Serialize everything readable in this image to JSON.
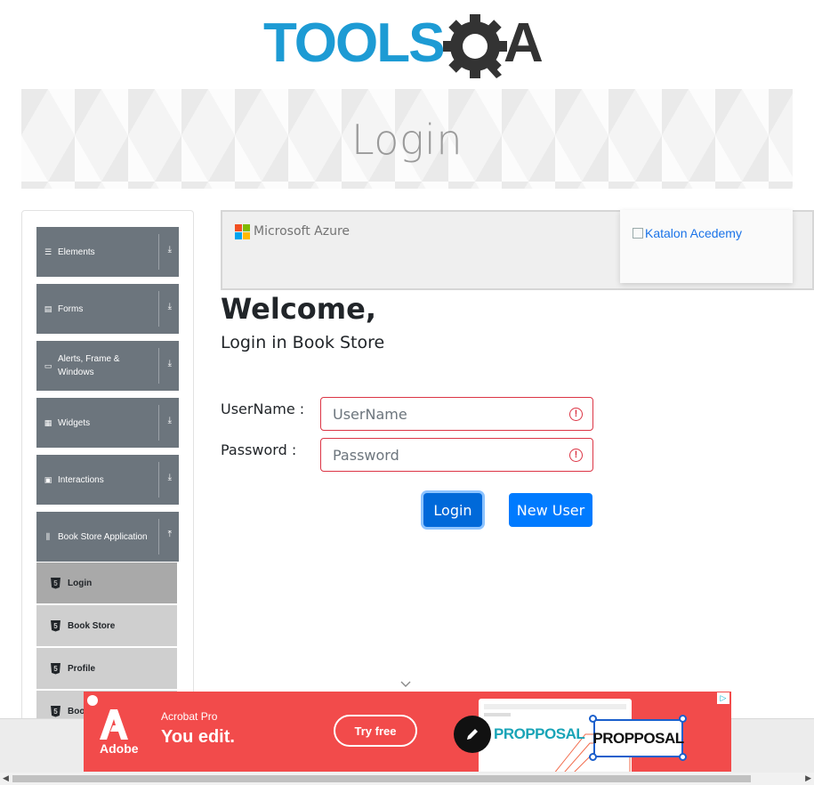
{
  "header": {
    "logo_text": "TOOLSQA"
  },
  "banner": {
    "title": "Login"
  },
  "sidebar": {
    "groups": [
      {
        "label": "Elements",
        "icon": "list-icon",
        "arrow": "⤓"
      },
      {
        "label": "Forms",
        "icon": "form-icon",
        "arrow": "⤓"
      },
      {
        "label": "Alerts, Frame & Windows",
        "icon": "window-icon",
        "arrow": "⤓"
      },
      {
        "label": "Widgets",
        "icon": "grid-icon",
        "arrow": "⤓"
      },
      {
        "label": "Interactions",
        "icon": "doc-icon",
        "arrow": "⤓"
      },
      {
        "label": "Book Store Application",
        "icon": "books-icon",
        "arrow": "⤒"
      }
    ],
    "subitems": [
      {
        "label": "Login",
        "active": true
      },
      {
        "label": "Book Store",
        "active": false
      },
      {
        "label": "Profile",
        "active": false
      },
      {
        "label": "Book Store API",
        "active": false
      }
    ],
    "h5_glyph": "5"
  },
  "ad_top": {
    "brand": "Microsoft Azure",
    "katalon_alt": "Katalon Acedemy"
  },
  "main": {
    "welcome": "Welcome,",
    "subtitle": "Login in Book Store",
    "username_label": "UserName :",
    "username_placeholder": "UserName",
    "password_label": "Password :",
    "password_placeholder": "Password",
    "error_glyph": "!",
    "login_button": "Login",
    "new_user_button": "New User"
  },
  "ad_bottom": {
    "brand": "Adobe",
    "product": "Acrobat Pro",
    "tagline": "You edit.",
    "cta": "Try free",
    "doc_text_1": "PROPPOSAL",
    "doc_text_2": "PROPPOSAL",
    "info_glyph": "▷"
  },
  "colors": {
    "primary": "#007bff",
    "sidebar_group": "#6c757d",
    "error": "#dc3545",
    "ad_red": "#f24b4b",
    "logo_blue": "#1d9bd4",
    "logo_dark": "#333333"
  }
}
